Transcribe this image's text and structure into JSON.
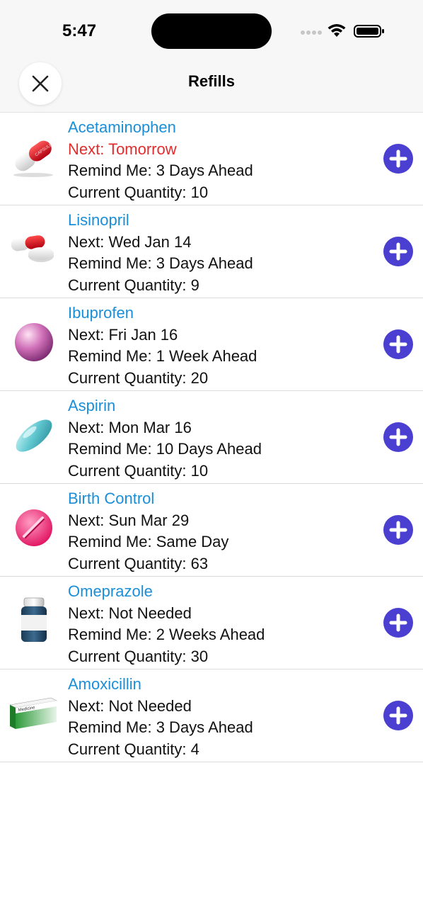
{
  "status_bar": {
    "time": "5:47"
  },
  "nav": {
    "title": "Refills",
    "close_icon": "close-icon"
  },
  "colors": {
    "name": "#1a8fd8",
    "next_soon": "#e02d2d",
    "add_button": "#4a3fd0"
  },
  "refills": [
    {
      "name": "Acetaminophen",
      "next": "Next: Tomorrow",
      "remind": "Remind Me: 3 Days Ahead",
      "quantity": "Current Quantity: 10",
      "icon": "capsule-icon",
      "capsule_text": "CAPSULE"
    },
    {
      "name": "Lisinopril",
      "next": "Next: Wed Jan 14",
      "remind": "Remind Me: 3 Days Ahead",
      "quantity": "Current Quantity: 9",
      "icon": "capsule-and-tablet-icon"
    },
    {
      "name": "Ibuprofen",
      "next": "Next: Fri Jan 16",
      "remind": "Remind Me: 1 Week Ahead",
      "quantity": "Current Quantity: 20",
      "icon": "round-pill-icon"
    },
    {
      "name": "Aspirin",
      "next": "Next: Mon Mar 16",
      "remind": "Remind Me: 10 Days Ahead",
      "quantity": "Current Quantity: 10",
      "icon": "oval-pill-icon"
    },
    {
      "name": "Birth Control",
      "next": "Next: Sun Mar 29",
      "remind": "Remind Me: Same Day",
      "quantity": "Current Quantity: 63",
      "icon": "scored-tablet-icon"
    },
    {
      "name": "Omeprazole",
      "next": "Next: Not Needed",
      "remind": "Remind Me: 2 Weeks Ahead",
      "quantity": "Current Quantity: 30",
      "icon": "pill-bottle-icon"
    },
    {
      "name": "Amoxicillin",
      "next": "Next: Not Needed",
      "remind": "Remind Me: 3 Days Ahead",
      "quantity": "Current Quantity: 4",
      "icon": "medicine-box-icon",
      "box_text": "Medicine"
    }
  ]
}
